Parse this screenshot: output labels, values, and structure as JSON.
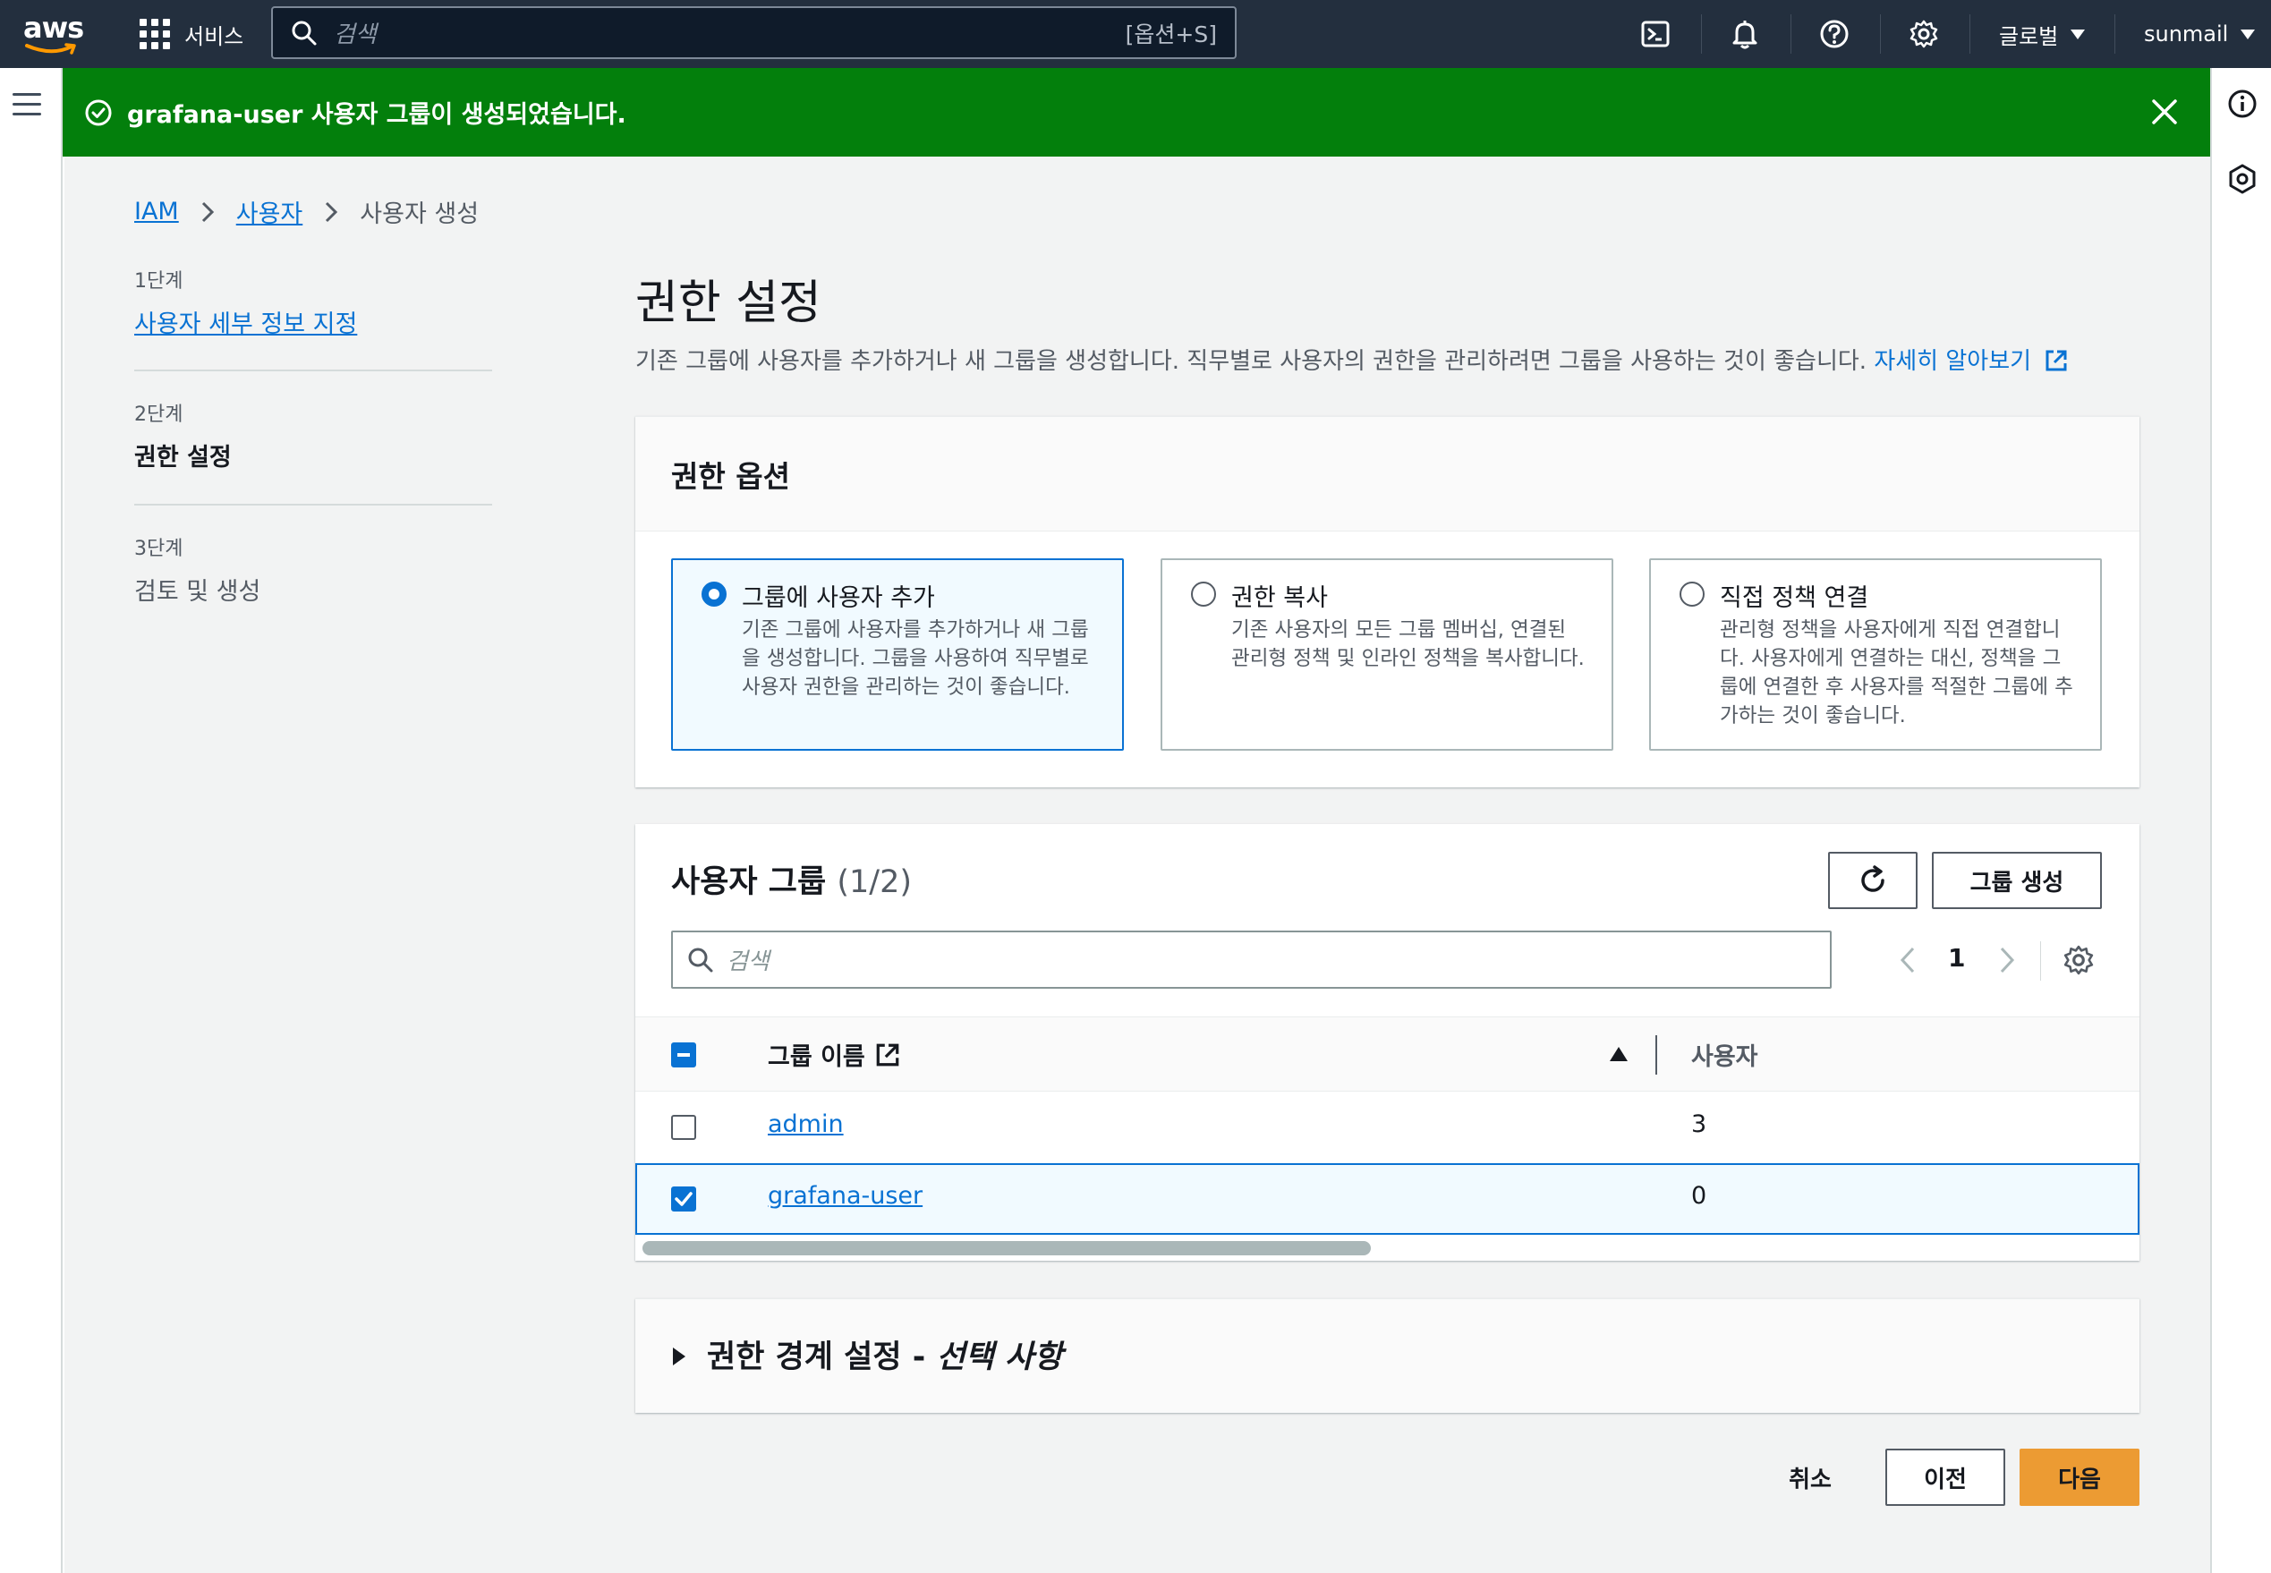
{
  "topnav": {
    "logo_text": "aws",
    "services_label": "서비스",
    "search_placeholder": "검색",
    "search_shortcut": "[옵션+S]",
    "region_label": "글로벌",
    "account_label": "sunmail"
  },
  "flash": {
    "message": "grafana-user 사용자 그룹이 생성되었습니다.",
    "color": "#037f0c"
  },
  "breadcrumb": {
    "items": [
      {
        "label": "IAM"
      },
      {
        "label": "사용자"
      },
      {
        "label": "사용자 생성"
      }
    ]
  },
  "steps": [
    {
      "label": "1단계",
      "title": "사용자 세부 정보 지정"
    },
    {
      "label": "2단계",
      "title": "권한 설정"
    },
    {
      "label": "3단계",
      "title": "검토 및 생성"
    }
  ],
  "page": {
    "title": "권한 설정",
    "description": "기존 그룹에 사용자를 추가하거나 새 그룹을 생성합니다. 직무별로 사용자의 권한을 관리하려면 그룹을 사용하는 것이 좋습니다.",
    "learn_more": "자세히 알아보기"
  },
  "permission_options": {
    "header": "권한 옵션",
    "options": [
      {
        "title": "그룹에 사용자 추가",
        "description": "기존 그룹에 사용자를 추가하거나 새 그룹을 생성합니다. 그룹을 사용하여 직무별로 사용자 권한을 관리하는 것이 좋습니다.",
        "selected": true
      },
      {
        "title": "권한 복사",
        "description": "기존 사용자의 모든 그룹 멤버십, 연결된 관리형 정책 및 인라인 정책을 복사합니다.",
        "selected": false
      },
      {
        "title": "직접 정책 연결",
        "description": "관리형 정책을 사용자에게 직접 연결합니다. 사용자에게 연결하는 대신, 정책을 그룹에 연결한 후 사용자를 적절한 그룹에 추가하는 것이 좋습니다.",
        "selected": false
      }
    ]
  },
  "user_groups": {
    "title": "사용자 그룹",
    "count": "(1/2)",
    "create_button": "그룹 생성",
    "search_placeholder": "검색",
    "page_number": "1",
    "columns": [
      "그룹 이름",
      "사용자"
    ],
    "rows": [
      {
        "name": "admin",
        "users": "3",
        "checked": false
      },
      {
        "name": "grafana-user",
        "users": "0",
        "checked": true
      }
    ]
  },
  "boundary": {
    "title_main": "권한 경계 설정 - ",
    "title_optional": "선택 사항"
  },
  "footer": {
    "cancel": "취소",
    "previous": "이전",
    "next": "다음"
  },
  "colors": {
    "primary_button": "#ec9b33",
    "link": "#0972d3",
    "nav_bg": "#232f3e"
  }
}
